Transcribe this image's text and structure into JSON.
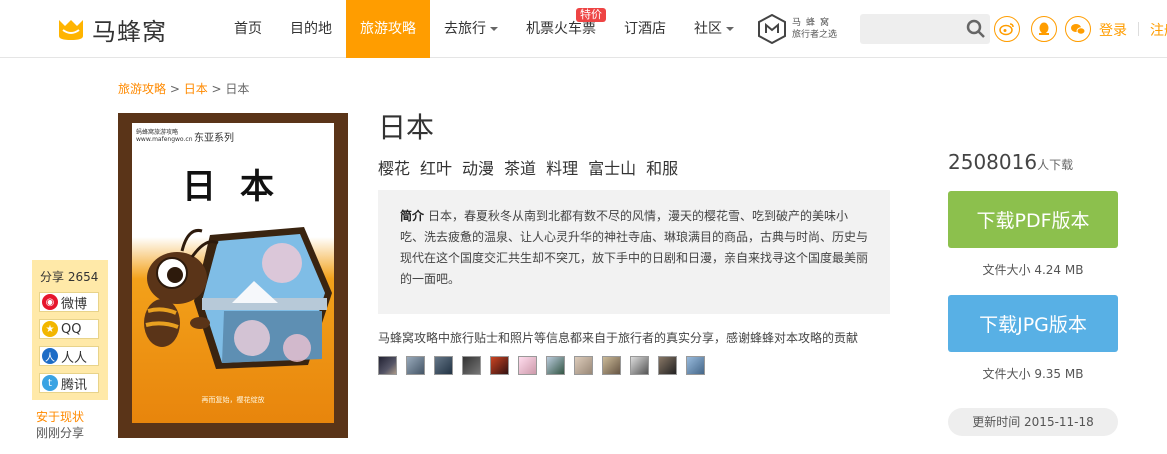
{
  "nav": {
    "logo_text": "马蜂窝",
    "items": [
      {
        "label": "首页"
      },
      {
        "label": "目的地"
      },
      {
        "label": "旅游攻略"
      },
      {
        "label": "去旅行"
      },
      {
        "label": "机票火车票"
      },
      {
        "label": "订酒店"
      },
      {
        "label": "社区"
      }
    ],
    "hot_badge": "特价",
    "brand_line1": "马蜂窝",
    "brand_line2": "旅行者之选",
    "search_placeholder": "",
    "login": "登录",
    "register": "注册"
  },
  "breadcrumb": {
    "root": "旅游攻略",
    "sep1": " > ",
    "country": "日本",
    "sep2": " > ",
    "current": "日本"
  },
  "cover": {
    "publisher": "蚂蜂窝旅游攻略 www.mafengwo.cn",
    "series": "东亚系列",
    "title": "日本",
    "slogan": "再而复始，樱花绽放"
  },
  "share": {
    "count_label": "分享 2654",
    "weibo": "微博",
    "qq": "QQ",
    "renren": "人人",
    "tencent": "腾讯",
    "security": "安于现状",
    "just_shared": "刚刚分享"
  },
  "guide": {
    "title": "日本",
    "tags": [
      "樱花",
      "红叶",
      "动漫",
      "茶道",
      "料理",
      "富士山",
      "和服"
    ],
    "intro_label": "简介",
    "intro_text": "日本，春夏秋冬从南到北都有数不尽的风情，漫天的樱花雪、吃到破产的美味小吃、洗去疲惫的温泉、让人心灵升华的神社寺庙、琳琅满目的商品，古典与时尚、历史与现代在这个国度交汇共生却不突兀，放下手中的日剧和日漫，亲自来找寻这个国度最美丽的一面吧。",
    "source_note": "马蜂窝攻略中旅行贴士和照片等信息都来自于旅行者的真实分享，感谢蜂蜂对本攻略的贡献"
  },
  "download": {
    "count": "2508016",
    "count_unit": "人下载",
    "pdf_label": "下载PDF版本",
    "pdf_size": "文件大小 4.24 MB",
    "jpg_label": "下载JPG版本",
    "jpg_size": "文件大小 9.35 MB",
    "updated": "更新时间 2015-11-18"
  },
  "colors": {
    "accent": "#ff9d00",
    "pdf": "#8cc04d",
    "jpg": "#58b0e5"
  }
}
